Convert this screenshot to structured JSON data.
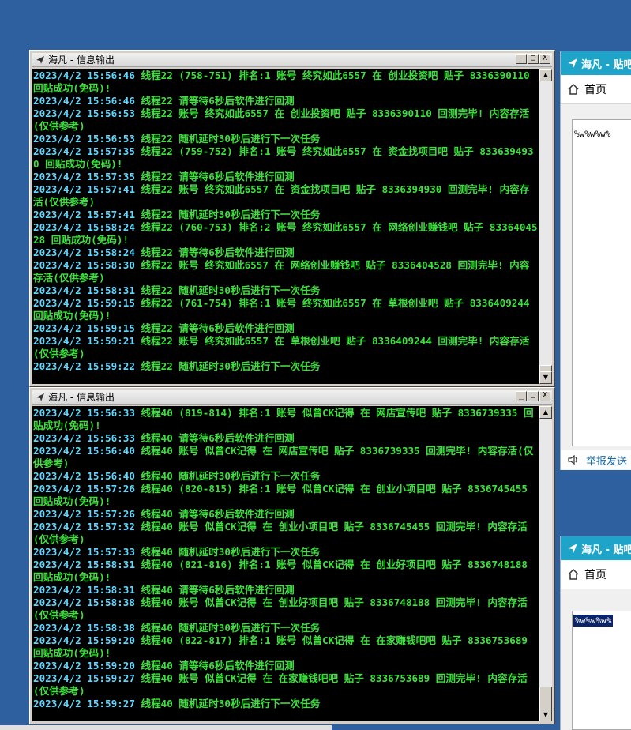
{
  "windows": [
    {
      "title": "海凡 - 信息输出",
      "controls": [
        "_",
        "□",
        "X"
      ],
      "lines": [
        {
          "ts": "2023/4/2 15:56:46",
          "msg": " 线程22 (758-751) 排名:1 账号 终究如此6557 在 创业投资吧 贴子 8336390110 回贴成功(免码)!"
        },
        {
          "ts": "2023/4/2 15:56:46",
          "msg": " 线程22 请等待6秒后软件进行回测"
        },
        {
          "ts": "2023/4/2 15:56:53",
          "msg": " 线程22 账号 终究如此6557 在 创业投资吧 贴子 8336390110 回测完毕! 内容存活(仅供参考)"
        },
        {
          "ts": "2023/4/2 15:56:53",
          "msg": " 线程22 随机延时30秒后进行下一次任务"
        },
        {
          "ts": "2023/4/2 15:57:35",
          "msg": " 线程22 (759-752) 排名:1 账号 终究如此6557 在 资金找项目吧 贴子 8336394930 回贴成功(免码)!"
        },
        {
          "ts": "2023/4/2 15:57:35",
          "msg": " 线程22 请等待6秒后软件进行回测"
        },
        {
          "ts": "2023/4/2 15:57:41",
          "msg": " 线程22 账号 终究如此6557 在 资金找项目吧 贴子 8336394930 回测完毕! 内容存活(仅供参考)"
        },
        {
          "ts": "2023/4/2 15:57:41",
          "msg": " 线程22 随机延时30秒后进行下一次任务"
        },
        {
          "ts": "2023/4/2 15:58:24",
          "msg": " 线程22 (760-753) 排名:2 账号 终究如此6557 在 网络创业赚钱吧 贴子 8336404528 回贴成功(免码)!"
        },
        {
          "ts": "2023/4/2 15:58:24",
          "msg": " 线程22 请等待6秒后软件进行回测"
        },
        {
          "ts": "2023/4/2 15:58:30",
          "msg": " 线程22 账号 终究如此6557 在 网络创业赚钱吧 贴子 8336404528 回测完毕! 内容存活(仅供参考)"
        },
        {
          "ts": "2023/4/2 15:58:31",
          "msg": " 线程22 随机延时30秒后进行下一次任务"
        },
        {
          "ts": "2023/4/2 15:59:15",
          "msg": " 线程22 (761-754) 排名:1 账号 终究如此6557 在 草根创业吧 贴子 8336409244 回贴成功(免码)!"
        },
        {
          "ts": "2023/4/2 15:59:15",
          "msg": " 线程22 请等待6秒后软件进行回测"
        },
        {
          "ts": "2023/4/2 15:59:21",
          "msg": " 线程22 账号 终究如此6557 在 草根创业吧 贴子 8336409244 回测完毕! 内容存活(仅供参考)"
        },
        {
          "ts": "2023/4/2 15:59:22",
          "msg": " 线程22 随机延时30秒后进行下一次任务"
        }
      ]
    },
    {
      "title": "海凡 - 信息输出",
      "controls": [
        "_",
        "□",
        "X"
      ],
      "lines": [
        {
          "ts": "2023/4/2 15:56:33",
          "msg": " 线程40 (819-814) 排名:1 账号 似曾CK记得 在 网店宣传吧 贴子 8336739335 回贴成功(免码)!"
        },
        {
          "ts": "2023/4/2 15:56:33",
          "msg": " 线程40 请等待6秒后软件进行回测"
        },
        {
          "ts": "2023/4/2 15:56:40",
          "msg": " 线程40 账号 似曾CK记得 在 网店宣传吧 贴子 8336739335 回测完毕! 内容存活(仅供参考)"
        },
        {
          "ts": "2023/4/2 15:56:40",
          "msg": " 线程40 随机延时30秒后进行下一次任务"
        },
        {
          "ts": "2023/4/2 15:57:26",
          "msg": " 线程40 (820-815) 排名:1 账号 似曾CK记得 在 创业小项目吧 贴子 8336745455 回贴成功(免码)!"
        },
        {
          "ts": "2023/4/2 15:57:26",
          "msg": " 线程40 请等待6秒后软件进行回测"
        },
        {
          "ts": "2023/4/2 15:57:32",
          "msg": " 线程40 账号 似曾CK记得 在 创业小项目吧 贴子 8336745455 回测完毕! 内容存活(仅供参考)"
        },
        {
          "ts": "2023/4/2 15:57:33",
          "msg": " 线程40 随机延时30秒后进行下一次任务"
        },
        {
          "ts": "2023/4/2 15:58:31",
          "msg": " 线程40 (821-816) 排名:1 账号 似曾CK记得 在 创业好项目吧 贴子 8336748188 回贴成功(免码)!"
        },
        {
          "ts": "2023/4/2 15:58:31",
          "msg": " 线程40 请等待6秒后软件进行回测"
        },
        {
          "ts": "2023/4/2 15:58:38",
          "msg": " 线程40 账号 似曾CK记得 在 创业好项目吧 贴子 8336748188 回测完毕! 内容存活(仅供参考)"
        },
        {
          "ts": "2023/4/2 15:58:38",
          "msg": " 线程40 随机延时30秒后进行下一次任务"
        },
        {
          "ts": "2023/4/2 15:59:20",
          "msg": " 线程40 (822-817) 排名:1 账号 似曾CK记得 在 在家赚钱吧吧 贴子 8336753689 回贴成功(免码)!"
        },
        {
          "ts": "2023/4/2 15:59:20",
          "msg": " 线程40 请等待6秒后软件进行回测"
        },
        {
          "ts": "2023/4/2 15:59:27",
          "msg": " 线程40 账号 似曾CK记得 在 在家赚钱吧吧 贴子 8336753689 回测完毕! 内容存活(仅供参考)"
        },
        {
          "ts": "2023/4/2 15:59:27",
          "msg": " 线程40 随机延时30秒后进行下一次任务"
        }
      ]
    }
  ],
  "apps": [
    {
      "title": "海凡 - 贴吧",
      "nav_label": "首页",
      "field_value": "%w%w%w%",
      "footer_label": "举报发送"
    },
    {
      "title": "海凡 - 贴吧",
      "nav_label": "首页",
      "field_value": "%w%w%w%"
    }
  ],
  "colors": {
    "desktop": "#2e5f9e",
    "timestamp": "#5fd7ff",
    "message": "#3ee03e",
    "app_title": "#1fa4c9"
  }
}
